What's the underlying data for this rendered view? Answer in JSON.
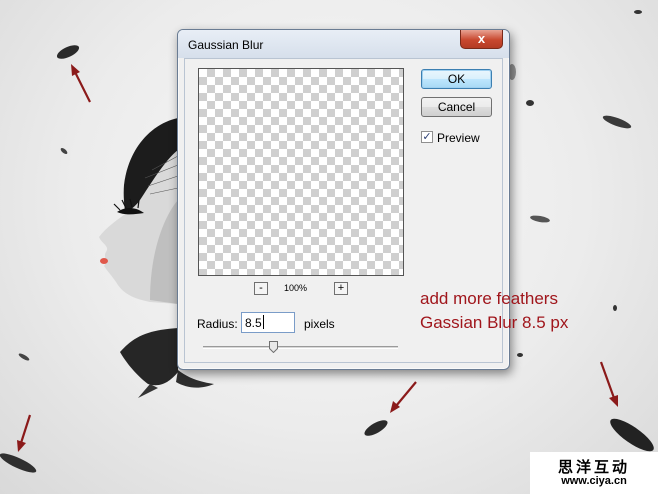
{
  "dialog": {
    "title": "Gaussian Blur",
    "close_glyph": "x",
    "ok_label": "OK",
    "cancel_label": "Cancel",
    "preview_label": "Preview",
    "preview_checked": true,
    "zoom_out_label": "-",
    "zoom_in_label": "+",
    "zoom_level": "100%",
    "radius_label": "Radius:",
    "radius_value": "8.5",
    "radius_unit": "pixels"
  },
  "annotation": {
    "line1": "add more feathers",
    "line2": "Gassian Blur 8.5 px"
  },
  "watermark": {
    "cn": "思洋互动",
    "url": "www.ciya.cn"
  },
  "colors": {
    "annotation": "#a0161c",
    "arrows": "#8b1a1a",
    "feathers": "#2a2a2a"
  }
}
